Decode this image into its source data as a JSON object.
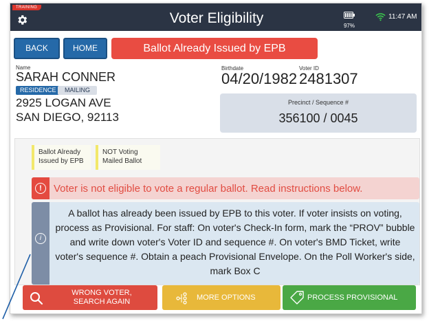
{
  "header": {
    "training_badge": "TRAINING",
    "title": "Voter Eligibility",
    "battery_pct": "97%",
    "clock": "11:47 AM"
  },
  "nav": {
    "back_label": "BACK",
    "home_label": "HOME",
    "status_banner": "Ballot Already Issued by EPB"
  },
  "voter": {
    "name_label": "Name",
    "name": "SARAH CONNER",
    "birthdate_label": "Birthdate",
    "birthdate": "04/20/1982",
    "voter_id_label": "Voter ID",
    "voter_id": "2481307",
    "address_tabs": [
      "RESIDENCE",
      "MAILING"
    ],
    "address_line1": "2925 LOGAN AVE",
    "address_line2": "SAN DIEGO, 92113",
    "precinct_label": "Precinct / Sequence #",
    "precinct_value": "356100 / 0045"
  },
  "reasons": [
    {
      "line1": "Ballot Already",
      "line2": "Issued by EPB"
    },
    {
      "line1": "NOT Voting",
      "line2": "Mailed Ballot"
    }
  ],
  "alerts": {
    "error_text": "Voter is not eligible to vote a regular ballot.  Read instructions below.",
    "info_text": "A ballot has already been issued by EPB to this voter. If voter insists on voting, process as Provisional. For staff: On voter's Check-In form, mark the “PROV” bubble and write down voter's Voter ID and sequence #. On voter's BMD Ticket, write voter's sequence #. Obtain a peach Provisional Envelope. On the Poll Worker's side, mark Box C"
  },
  "actions": {
    "wrong_voter_line1": "WRONG VOTER,",
    "wrong_voter_line2": "SEARCH AGAIN",
    "more_options": "MORE OPTIONS",
    "process_provisional": "PROCESS PROVISIONAL"
  },
  "colors": {
    "titlebar": "#2b3444",
    "primary_blue": "#2569a8",
    "danger_red": "#e94c42",
    "warning_yellow": "#e8b83a",
    "success_green": "#4aa845"
  },
  "icons": [
    "gear-icon",
    "battery-icon",
    "wifi-icon",
    "alert-circle-icon",
    "info-circle-icon",
    "search-icon",
    "options-icon",
    "tag-icon"
  ]
}
